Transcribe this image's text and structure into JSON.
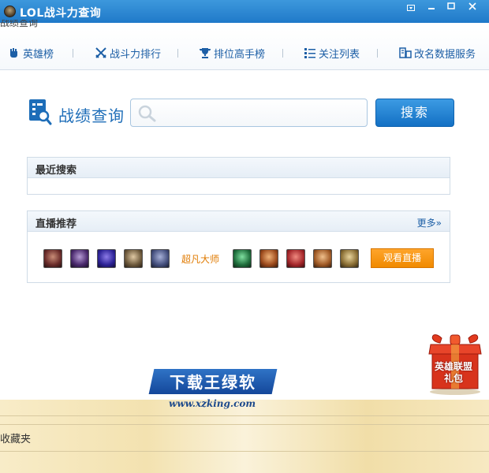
{
  "window": {
    "title": "LOL战斗力查询",
    "clipped_text": "战绩查询"
  },
  "nav": {
    "items": [
      {
        "label": "英雄榜",
        "icon": "fist-icon"
      },
      {
        "label": "战斗力排行",
        "icon": "crossed-swords-icon"
      },
      {
        "label": "排位高手榜",
        "icon": "trophy-icon"
      },
      {
        "label": "关注列表",
        "icon": "list-icon"
      },
      {
        "label": "改名数据服务",
        "icon": "rename-data-icon"
      }
    ]
  },
  "search": {
    "label": "战绩查询",
    "input_value": "",
    "placeholder": "",
    "button_label": "搜索"
  },
  "recent": {
    "title": "最近搜索"
  },
  "live": {
    "title": "直播推荐",
    "more_label": "更多»",
    "streamer_name": "超凡大师",
    "watch_label": "观看直播"
  },
  "gift": {
    "line1": "英雄联盟",
    "line2": "礼包"
  },
  "watermark": {
    "title": "下载王绿软",
    "url": "www.xzking.com"
  },
  "footer": {
    "favorites_label": "收藏夹"
  },
  "colors": {
    "titlebar": "#2a86d2",
    "accent_blue": "#1d6db8",
    "orange": "#f08a00"
  }
}
